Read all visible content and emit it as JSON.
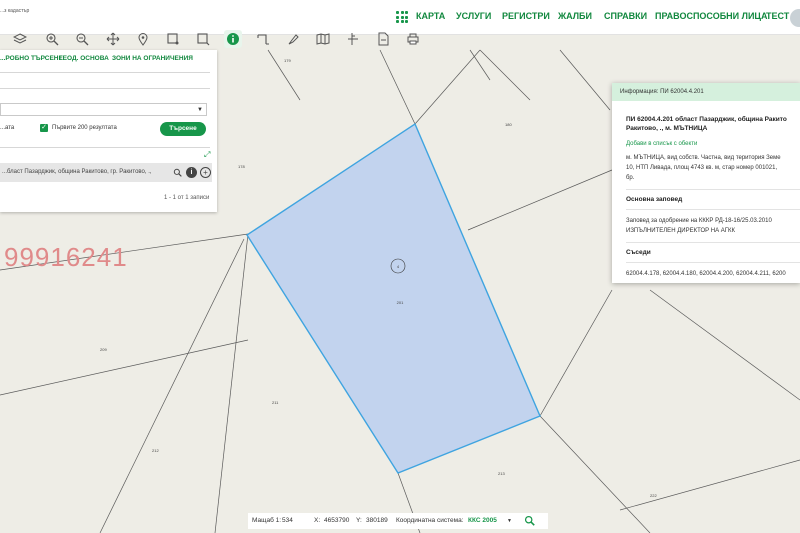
{
  "brand": "...з кадастър",
  "nav": {
    "items": [
      "КАРТА",
      "УСЛУГИ",
      "РЕГИСТРИ",
      "ЖАЛБИ",
      "СПРАВКИ",
      "ПРАВОСПОСОБНИ ЛИЦА",
      "ТЕСТ"
    ]
  },
  "toolbar": {
    "icons": [
      "layers-icon",
      "zoom-in-icon",
      "zoom-out-icon",
      "pan-icon",
      "location-pin-icon",
      "select-area-icon",
      "crop-icon",
      "info-icon",
      "cut-icon",
      "brush-icon",
      "map-icon",
      "measure-icon",
      "document-icon",
      "print-icon"
    ]
  },
  "search_panel": {
    "tabs": [
      "...РОБНО ТЪРСЕНЕ",
      "ГЕОД. ОСНОВА",
      "ЗОНИ НА ОГРАНИЧЕНИЯ"
    ],
    "field_label_left": "...ата",
    "first200_label": "Първите 200 резултата",
    "search_button": "Търсене",
    "result_text": "...бласт Пазарджик, община Ракитово, гр. Ракитово, ., ",
    "pager": "1 - 1 от 1 записи"
  },
  "watermark": "99916241",
  "map": {
    "selected_parcel": "201",
    "selected_marker": "4",
    "labels": [
      "179",
      "180",
      "178",
      "209",
      "211",
      "212",
      "213",
      "222"
    ]
  },
  "info_panel": {
    "header": "Информация: ПИ 62004.4.201",
    "title_line1": "ПИ 62004.4.201 област Пазарджик, община Ракито",
    "title_line2": "Ракитово, ., м. МЪТНИЦА",
    "add_link": "Добави в списък с обекти",
    "desc_line1": "м. МЪТНИЦА, вид собств. Частна, вид територия Земе",
    "desc_line2": "10, НТП Ливада, площ 4743 кв. м, стар номер 001021,",
    "desc_line3": "бр.",
    "order_title": "Основна заповед",
    "order_line1": "Заповед за одобрение на КККР РД-18-16/25.03.2010",
    "order_line2": "ИЗПЪЛНИТЕЛЕН ДИРЕКТОР НА АГКК",
    "neighbors_title": "Съседи",
    "neighbors": "62004.4.178, 62004.4.180, 62004.4.200, 62004.4.211, 6200"
  },
  "status_bar": {
    "scale_label": "Мащаб 1:",
    "scale_value": "534",
    "x_label": "X:",
    "x_value": "4653790",
    "y_label": "Y:",
    "y_value": "380189",
    "crs_label": "Координатна система:",
    "crs_value": "ККС 2005"
  },
  "colors": {
    "accent": "#17964a",
    "parcel_fill": "#c2d3ee",
    "parcel_stroke": "#3fa4e0",
    "map_bg": "#eeede6",
    "info_header": "#d5f0dd"
  }
}
